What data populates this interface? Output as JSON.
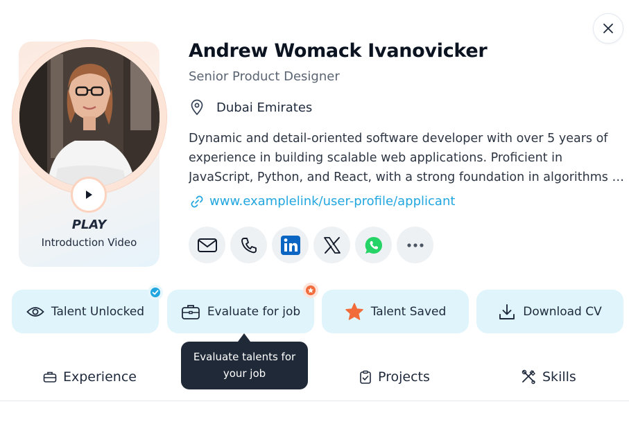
{
  "profile": {
    "name": "Andrew Womack Ivanovicker",
    "title": "Senior Product Designer",
    "location": "Dubai Emirates",
    "bio_lines": [
      "Dynamic and detail-oriented software developer with over 5 years of",
      "experience in building scalable web applications. Proficient in",
      "JavaScript, Python, and React, with a strong foundation in algorithms a…"
    ],
    "link": "www.examplelink/user-profile/applicant"
  },
  "video": {
    "play_label": "PLAY",
    "caption": "Introduction Video"
  },
  "social": [
    {
      "icon": "mail-icon"
    },
    {
      "icon": "phone-icon"
    },
    {
      "icon": "linkedin-icon"
    },
    {
      "icon": "x-icon"
    },
    {
      "icon": "whatsapp-icon"
    },
    {
      "icon": "more-icon"
    }
  ],
  "actions": {
    "talent_unlocked": "Talent Unlocked",
    "evaluate_for_job": "Evaluate for job",
    "talent_saved": "Talent Saved",
    "download_cv": "Download CV"
  },
  "tooltip": {
    "line1": "Evaluate talents for",
    "line2": "your job"
  },
  "tabs": {
    "experience": "Experience",
    "projects": "Projects",
    "skills": "Skills"
  },
  "colors": {
    "accent": "#22a6e0",
    "action_bg": "#dff4fb",
    "star": "#f26b3a",
    "whatsapp": "#25d366",
    "linkedin": "#0a66c2"
  }
}
